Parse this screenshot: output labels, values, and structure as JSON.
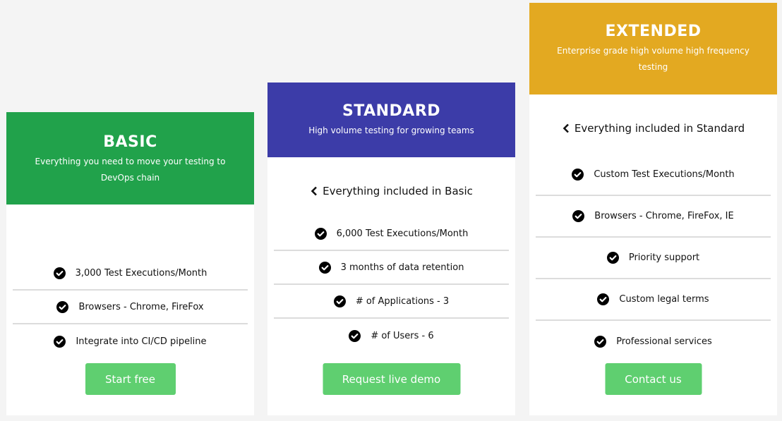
{
  "colors": {
    "page_background": "#f4f4f4",
    "basic": "#21a24b",
    "standard": "#3c3ca8",
    "extended": "#e3a921",
    "cta": "#5fcf70"
  },
  "plans": [
    {
      "id": "basic",
      "title": "BASIC",
      "subtitle": "Everything you need to move your testing to DevOps chain",
      "included": null,
      "features": [
        "3,000 Test Executions/Month",
        "Browsers - Chrome, FireFox",
        "Integrate into CI/CD pipeline"
      ],
      "cta": "Start free"
    },
    {
      "id": "standard",
      "title": "STANDARD",
      "subtitle": "High volume testing for growing teams",
      "included": "Everything included in Basic",
      "features": [
        "6,000 Test Executions/Month",
        "3 months of data retention",
        "# of Applications - 3",
        "# of Users - 6"
      ],
      "cta": "Request live demo"
    },
    {
      "id": "extended",
      "title": "EXTENDED",
      "subtitle": "Enterprise grade high volume high frequency testing",
      "included": "Everything included in Standard",
      "features": [
        "Custom Test Executions/Month",
        "Browsers - Chrome, FireFox, IE",
        "Priority support",
        "Custom legal terms",
        "Professional services"
      ],
      "cta": "Contact us"
    }
  ],
  "icons": {
    "feature": "check-circle-icon",
    "included": "chevron-left-icon"
  }
}
